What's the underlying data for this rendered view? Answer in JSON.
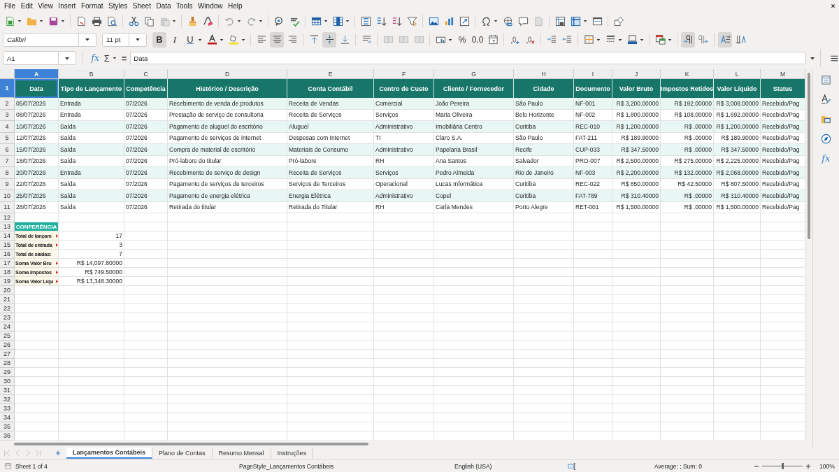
{
  "menu": [
    "File",
    "Edit",
    "View",
    "Insert",
    "Format",
    "Styles",
    "Sheet",
    "Data",
    "Tools",
    "Window",
    "Help"
  ],
  "format_bar": {
    "font": "Calibri",
    "size": "11 pt",
    "styles": [
      {
        "label": "B",
        "on": true
      },
      {
        "label": "I",
        "on": false
      },
      {
        "label": "U",
        "on": false
      }
    ],
    "align": [
      {
        "selected": false
      },
      {
        "selected": true
      },
      {
        "selected": false
      }
    ],
    "valign": [
      {
        "selected": false
      },
      {
        "selected": true
      },
      {
        "selected": false
      }
    ],
    "number_buttons": [
      "%",
      "0.0"
    ],
    "direction": [
      {
        "selected": true
      },
      {
        "selected": false
      }
    ],
    "text_flow": [
      {
        "on": true
      },
      {
        "on": false
      }
    ]
  },
  "formula_bar": {
    "name_box": "A1",
    "function_wizard": "fx",
    "sum": "Σ",
    "equals": "=",
    "value": "Data"
  },
  "sheet": {
    "columns": [
      {
        "letter": "A",
        "selected": true
      },
      {
        "letter": "B",
        "selected": false
      },
      {
        "letter": "C",
        "selected": false
      },
      {
        "letter": "D",
        "selected": false
      },
      {
        "letter": "E",
        "selected": false
      },
      {
        "letter": "F",
        "selected": false
      },
      {
        "letter": "G",
        "selected": false
      },
      {
        "letter": "H",
        "selected": false
      },
      {
        "letter": "I",
        "selected": false
      },
      {
        "letter": "J",
        "selected": false
      },
      {
        "letter": "K",
        "selected": false
      },
      {
        "letter": "L",
        "selected": false
      },
      {
        "letter": "M",
        "selected": false
      }
    ],
    "row_numbers": [
      {
        "label": "1",
        "selected": true
      },
      {
        "label": "2",
        "selected": false
      },
      {
        "label": "3",
        "selected": false
      },
      {
        "label": "4",
        "selected": false
      },
      {
        "label": "5",
        "selected": false
      },
      {
        "label": "6",
        "selected": false
      },
      {
        "label": "7",
        "selected": false
      },
      {
        "label": "8",
        "selected": false
      },
      {
        "label": "9",
        "selected": false
      },
      {
        "label": "10",
        "selected": false
      },
      {
        "label": "11",
        "selected": false
      },
      {
        "label": "12",
        "selected": false
      },
      {
        "label": "13",
        "selected": false
      },
      {
        "label": "14",
        "selected": false
      },
      {
        "label": "15",
        "selected": false
      },
      {
        "label": "16",
        "selected": false
      },
      {
        "label": "17",
        "selected": false
      },
      {
        "label": "18",
        "selected": false
      },
      {
        "label": "19",
        "selected": false
      },
      {
        "label": "20",
        "selected": false
      },
      {
        "label": "21",
        "selected": false
      },
      {
        "label": "22",
        "selected": false
      },
      {
        "label": "23",
        "selected": false
      },
      {
        "label": "24",
        "selected": false
      },
      {
        "label": "25",
        "selected": false
      },
      {
        "label": "26",
        "selected": false
      },
      {
        "label": "27",
        "selected": false
      },
      {
        "label": "28",
        "selected": false
      },
      {
        "label": "29",
        "selected": false
      },
      {
        "label": "30",
        "selected": false
      },
      {
        "label": "31",
        "selected": false
      },
      {
        "label": "32",
        "selected": false
      },
      {
        "label": "33",
        "selected": false
      },
      {
        "label": "34",
        "selected": false
      },
      {
        "label": "35",
        "selected": false
      },
      {
        "label": "36",
        "selected": false
      }
    ],
    "header_row": [
      {
        "text": "Data",
        "selected": true
      },
      {
        "text": "Tipo de Lançamento",
        "selected": false
      },
      {
        "text": "Competência",
        "selected": false
      },
      {
        "text": "Histórico / Descrição",
        "selected": false
      },
      {
        "text": "Conta Contábil",
        "selected": false
      },
      {
        "text": "Centro de Custo",
        "selected": false
      },
      {
        "text": "Cliente / Fornecedor",
        "selected": false
      },
      {
        "text": "Cidade",
        "selected": false
      },
      {
        "text": "Documento",
        "selected": false
      },
      {
        "text": "Valor Bruto",
        "selected": false
      },
      {
        "text": "Impostos Retidos",
        "selected": false
      },
      {
        "text": "Valor Líquido",
        "selected": false
      },
      {
        "text": "Status",
        "selected": false
      }
    ],
    "data_rows": [
      [
        "05/07/2026",
        "Entrada",
        "07/2026",
        "Recebimento de venda de produtos",
        "Receita de Vendas",
        "Comercial",
        "João Pereira",
        "São Paulo",
        "NF-001",
        "R$ 3,200.00000",
        "R$ 192.00000",
        "R$ 3,008.00000",
        "Recebido/Pag"
      ],
      [
        "08/07/2026",
        "Entrada",
        "07/2026",
        "Prestação de serviço de consultoria",
        "Receita de Serviços",
        "Serviços",
        "Maria Oliveira",
        "Belo Horizonte",
        "NF-002",
        "R$ 1,800.00000",
        "R$ 108.00000",
        "R$ 1,692.00000",
        "Recebido/Pag"
      ],
      [
        "10/07/2026",
        "Saída",
        "07/2026",
        "Pagamento de aluguel do escritório",
        "Aluguel",
        "Administrativo",
        "Imobiliária Centro",
        "Curitiba",
        "REC-010",
        "R$ 1,200.00000",
        "R$ .00000",
        "R$ 1,200.00000",
        "Recebido/Pag"
      ],
      [
        "12/07/2026",
        "Saída",
        "07/2026",
        "Pagamento de serviços de internet",
        "Despesas com Internet",
        "TI",
        "Claro S.A.",
        "São Paulo",
        "FAT-211",
        "R$ 189.90000",
        "R$ .00000",
        "R$ 189.90000",
        "Recebido/Pag"
      ],
      [
        "15/07/2026",
        "Saída",
        "07/2026",
        "Compra de material de escritório",
        "Materiais de Consumo",
        "Administrativo",
        "Papelaria Brasil",
        "Recife",
        "CUP-033",
        "R$ 347.50000",
        "R$ .00000",
        "R$ 347.50000",
        "Recebido/Pag"
      ],
      [
        "18/07/2026",
        "Saída",
        "07/2026",
        "Pró-labore do titular",
        "Pró-labore",
        "RH",
        "Ana Santos",
        "Salvador",
        "PRO-007",
        "R$ 2,500.00000",
        "R$ 275.00000",
        "R$ 2,225.00000",
        "Recebido/Pag"
      ],
      [
        "20/07/2026",
        "Entrada",
        "07/2026",
        "Recebimento de serviço de design",
        "Receita de Serviços",
        "Serviços",
        "Pedro Almeida",
        "Rio de Janeiro",
        "NF-003",
        "R$ 2,200.00000",
        "R$ 132.00000",
        "R$ 2,068.00000",
        "Recebido/Pag"
      ],
      [
        "22/07/2026",
        "Saída",
        "07/2026",
        "Pagamento de serviços de terceiros",
        "Serviços de Terceiros",
        "Operacional",
        "Lucas Informática",
        "Curitiba",
        "REC-022",
        "R$ 850.00000",
        "R$ 42.50000",
        "R$ 807.50000",
        "Recebido/Pag"
      ],
      [
        "25/07/2026",
        "Saída",
        "07/2026",
        "Pagamento de energia elétrica",
        "Energia Elétrica",
        "Administrativo",
        "Copel",
        "Curitiba",
        "FAT-789",
        "R$ 310.40000",
        "R$ .00000",
        "R$ 310.40000",
        "Recebido/Pag"
      ],
      [
        "28/07/2026",
        "Saída",
        "07/2026",
        "Retirada do titular",
        "Retirada do Titular",
        "RH",
        "Carla Mendes",
        "Porto Alegre",
        "RET-001",
        "R$ 1,500.00000",
        "R$ .00000",
        "R$ 1,500.00000",
        "Recebido/Pag"
      ]
    ],
    "conference": {
      "title": "CONFERÊNCIA",
      "items": [
        {
          "label": "Total de lançam",
          "overflow": true,
          "value": "17"
        },
        {
          "label": "Total de entrada",
          "overflow": true,
          "value": "3"
        },
        {
          "label": "Total de saídas:",
          "overflow": false,
          "value": "7"
        },
        {
          "label": "Soma Valor Bru",
          "overflow": true,
          "value": "R$ 14,097.80000"
        },
        {
          "label": "Soma Impostos",
          "overflow": true,
          "value": "R$ 749.50000"
        },
        {
          "label": "Soma Valor Líqu",
          "overflow": true,
          "value": "R$ 13,348.30000"
        }
      ]
    }
  },
  "sheet_tabs": [
    {
      "label": "Lançamentos Contábeis",
      "selected": true
    },
    {
      "label": "Plano de Contas",
      "selected": false
    },
    {
      "label": "Resumo Mensal",
      "selected": false
    },
    {
      "label": "Instruções",
      "selected": false
    }
  ],
  "status_bar": {
    "sheet": "Sheet 1 of 4",
    "page_style": "PageStyle_Lançamentos Contábeis",
    "language": "English (USA)",
    "summary": "Average: ; Sum: 0",
    "zoom": "100%"
  },
  "zoom_slider": {
    "level": 0.5
  },
  "sidebar": {
    "functions": "fx"
  }
}
